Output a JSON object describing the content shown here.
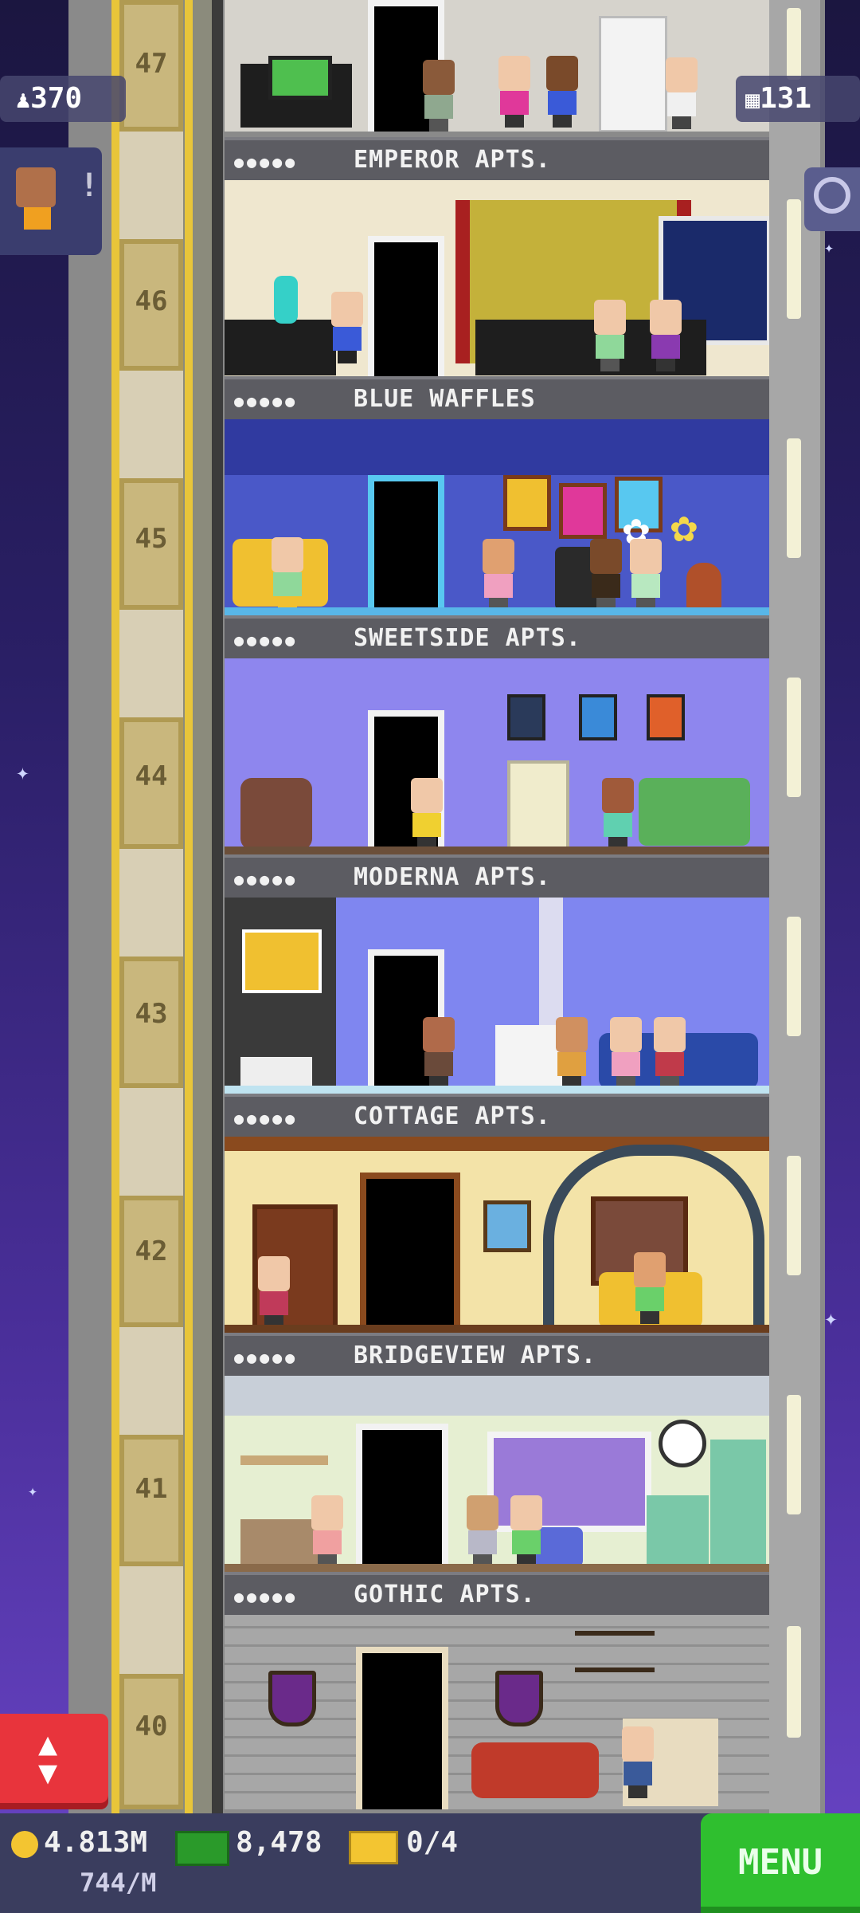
{
  "hud": {
    "population": "370",
    "floors_count": "131"
  },
  "floors": [
    {
      "number": "47",
      "name": "EMPEROR APTS.",
      "wall": "#d9d6d0",
      "floor_color": "#4a4a52"
    },
    {
      "number": "46",
      "name": "BLUE WAFFLES",
      "wall": "#efe7cf",
      "floor_color": "#7a1a1a"
    },
    {
      "number": "45",
      "name": "SWEETSIDE APTS.",
      "wall": "#4a58c8",
      "floor_color": "#58b6e8"
    },
    {
      "number": "44",
      "name": "MODERNA APTS.",
      "wall": "#8e86ee",
      "floor_color": "#6b4f3a"
    },
    {
      "number": "43",
      "name": "COTTAGE APTS.",
      "wall": "#7f86f0",
      "floor_color": "#bfe3f0"
    },
    {
      "number": "42",
      "name": "BRIDGEVIEW APTS.",
      "wall": "#f3e3a8",
      "floor_color": "#6a3d1e"
    },
    {
      "number": "41",
      "name": "GOTHIC APTS.",
      "wall": "#e6efd2",
      "floor_color": "#8a6a4a"
    },
    {
      "number": "40",
      "name": "",
      "wall": "#a7a7a7",
      "floor_color": "#6a6a6a"
    }
  ],
  "bottom_bar": {
    "coins": "4.813M",
    "coins_rate": "744/M",
    "bux": "8,478",
    "tickets": "0/4",
    "menu_label": "MENU"
  },
  "colors": {
    "menu_green": "#2fbf2f",
    "elevator_red": "#e8343c",
    "coin_gold": "#f3c531"
  },
  "icons": [
    "people-icon",
    "floors-grid-icon",
    "search-icon",
    "elevator-arrows-icon",
    "coin-icon",
    "bux-icon",
    "ticket-icon"
  ]
}
